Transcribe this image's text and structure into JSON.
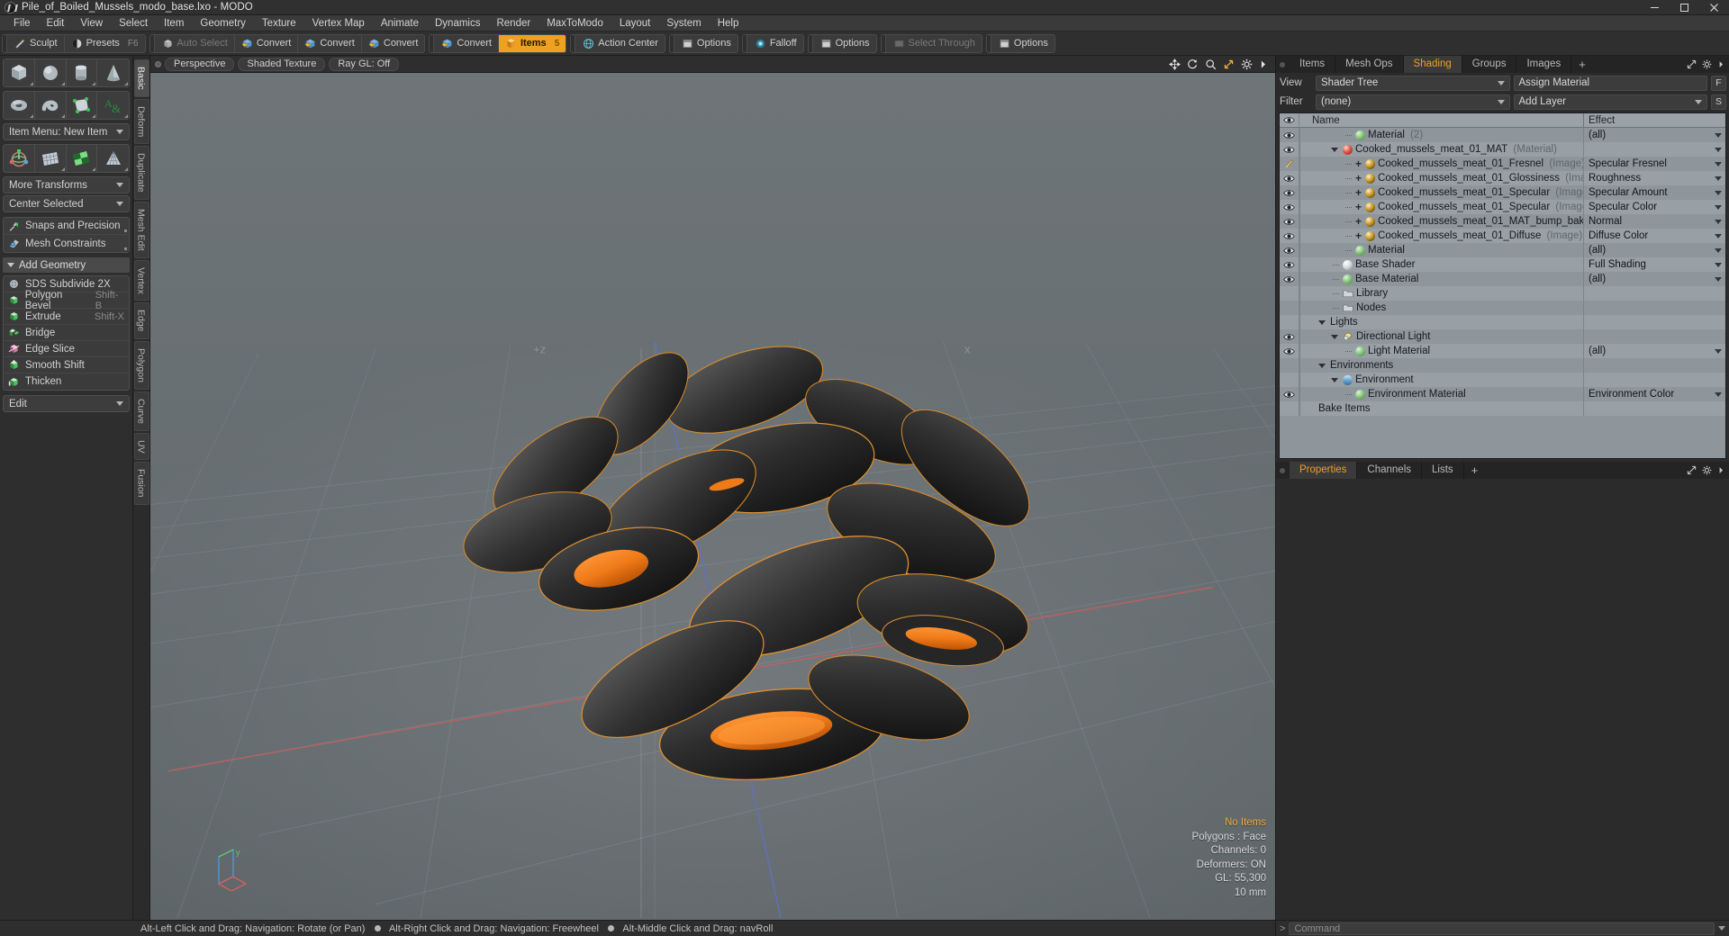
{
  "window": {
    "title": "Pile_of_Boiled_Mussels_modo_base.lxo - MODO",
    "minimize": "─",
    "maximize": "□",
    "close": "✕"
  },
  "menubar": [
    "File",
    "Edit",
    "View",
    "Select",
    "Item",
    "Geometry",
    "Texture",
    "Vertex Map",
    "Animate",
    "Dynamics",
    "Render",
    "MaxToModo",
    "Layout",
    "System",
    "Help"
  ],
  "toolbar": {
    "group1": [
      {
        "label": "Sculpt",
        "icon": "pencil-icon",
        "state": "normal",
        "key": ""
      },
      {
        "label": "Presets",
        "icon": "sphere-icon",
        "state": "normal",
        "key": "F6"
      }
    ],
    "group2": [
      {
        "label": "Auto Select",
        "icon": "cube-grey-icon",
        "state": "disabled",
        "key": ""
      },
      {
        "label": "Convert",
        "icon": "cube-blue-icon",
        "state": "normal",
        "key": ""
      },
      {
        "label": "Convert",
        "icon": "cube-blue-icon",
        "state": "normal",
        "key": ""
      },
      {
        "label": "Convert",
        "icon": "cube-blue-icon",
        "state": "normal",
        "key": ""
      }
    ],
    "group3": [
      {
        "label": "Convert",
        "icon": "cube-blue-icon",
        "state": "normal",
        "key": ""
      },
      {
        "label": "Items",
        "icon": "cube-orange-icon",
        "state": "active",
        "key": "5"
      }
    ],
    "group4": [
      {
        "label": "Action Center",
        "icon": "globe-icon",
        "state": "normal",
        "key": ""
      }
    ],
    "group5": [
      {
        "label": "Options",
        "icon": "panel-icon",
        "state": "normal",
        "key": ""
      }
    ],
    "group6": [
      {
        "label": "Falloff",
        "icon": "falloff-icon",
        "state": "normal",
        "key": ""
      }
    ],
    "group7": [
      {
        "label": "Options",
        "icon": "panel-icon",
        "state": "normal",
        "key": ""
      }
    ],
    "group8": [
      {
        "label": "Select Through",
        "icon": "through-icon",
        "state": "disabled",
        "key": ""
      }
    ],
    "group9": [
      {
        "label": "Options",
        "icon": "panel-icon",
        "state": "normal",
        "key": ""
      }
    ]
  },
  "left_panel": {
    "primitives_row1": [
      "cube-icon",
      "sphere-icon",
      "cylinder-icon",
      "cone-icon"
    ],
    "primitives_row2": [
      "torus-icon",
      "spiral-icon",
      "polygon-point-icon",
      "text-icon"
    ],
    "item_menu": {
      "label": "Item Menu: New Item"
    },
    "transform_row": [
      "transform-gizmo-icon",
      "grid-flat-icon",
      "checker-green-icon",
      "grid-fan-icon"
    ],
    "more_transforms": "More Transforms",
    "center_selected": "Center Selected",
    "snaps": {
      "label": "Snaps and Precision",
      "icon": "snap-icon"
    },
    "mesh_constraints": {
      "label": "Mesh Constraints",
      "icon": "constraint-icon"
    },
    "add_geometry_header": "Add Geometry",
    "tools": [
      {
        "label": "SDS Subdivide 2X",
        "shortcut": "",
        "icon": "subdivide-icon"
      },
      {
        "label": "Polygon Bevel",
        "shortcut": "Shift-B",
        "icon": "bevel-icon"
      },
      {
        "label": "Extrude",
        "shortcut": "Shift-X",
        "icon": "extrude-icon"
      },
      {
        "label": "Bridge",
        "shortcut": "",
        "icon": "bridge-icon"
      },
      {
        "label": "Edge Slice",
        "shortcut": "",
        "icon": "slice-icon"
      },
      {
        "label": "Smooth Shift",
        "shortcut": "",
        "icon": "smoothshift-icon"
      },
      {
        "label": "Thicken",
        "shortcut": "",
        "icon": "thicken-icon"
      }
    ],
    "edit_dropdown": "Edit"
  },
  "vertical_tabs": [
    {
      "label": "Basic",
      "active": true
    },
    {
      "label": "Deform",
      "active": false
    },
    {
      "label": "Duplicate",
      "active": false
    },
    {
      "label": "Mesh Edit",
      "active": false
    },
    {
      "label": "Vertex",
      "active": false
    },
    {
      "label": "Edge",
      "active": false
    },
    {
      "label": "Polygon",
      "active": false
    },
    {
      "label": "Curve",
      "active": false
    },
    {
      "label": "UV",
      "active": false
    },
    {
      "label": "Fusion",
      "active": false
    }
  ],
  "viewport": {
    "pills": [
      "Perspective",
      "Shaded Texture",
      "Ray GL: Off"
    ],
    "tool_icons": [
      "move-icon",
      "rotate-icon",
      "zoom-icon",
      "fit-icon",
      "gear-icon",
      "chevron-right-icon"
    ],
    "stats": {
      "items": "No Items",
      "polygons": "Polygons : Face",
      "channels": "Channels: 0",
      "deformers": "Deformers: ON",
      "gl": "GL: 55,300",
      "scale": "10 mm"
    },
    "axis_labels": {
      "x": "x",
      "y": "y",
      "z": "z"
    }
  },
  "right_panel": {
    "tabs": [
      {
        "label": "Items",
        "active": false
      },
      {
        "label": "Mesh Ops",
        "active": false
      },
      {
        "label": "Shading",
        "active": true
      },
      {
        "label": "Groups",
        "active": false
      },
      {
        "label": "Images",
        "active": false
      }
    ],
    "tab_plus": "+",
    "controls": {
      "view_label": "View",
      "view_value": "Shader Tree",
      "filter_label": "Filter",
      "filter_value": "(none)",
      "assign_material": "Assign Material",
      "add_layer": "Add Layer",
      "btn_f": "F",
      "btn_s": "S"
    },
    "tree_headers": {
      "eye": "eye-icon",
      "name": "Name",
      "effect": "Effect"
    },
    "tree_rows": [
      {
        "eye": "eye",
        "indent": 3,
        "expander": "",
        "icon": "sphere-green",
        "name": "Material",
        "suffix": "(2)",
        "effect": "(all)",
        "has_caret": true,
        "plus": false
      },
      {
        "eye": "eye",
        "indent": 2,
        "expander": "down",
        "icon": "sphere-red",
        "name": "Cooked_mussels_meat_01_MAT",
        "suffix": "(Material)",
        "effect": "",
        "has_caret": true,
        "plus": false
      },
      {
        "eye": "brush",
        "indent": 3,
        "expander": "",
        "icon": "sphere-gold",
        "name": "Cooked_mussels_meat_01_Fresnel",
        "suffix": "(Image)",
        "effect": "Specular Fresnel",
        "has_caret": true,
        "plus": true
      },
      {
        "eye": "eye",
        "indent": 3,
        "expander": "",
        "icon": "sphere-gold",
        "name": "Cooked_mussels_meat_01_Glossiness",
        "suffix": "(Image)",
        "effect": "Roughness",
        "has_caret": true,
        "plus": true
      },
      {
        "eye": "eye",
        "indent": 3,
        "expander": "",
        "icon": "sphere-gold",
        "name": "Cooked_mussels_meat_01_Specular",
        "suffix": "(Image ...",
        "effect": "Specular Amount",
        "has_caret": true,
        "plus": true
      },
      {
        "eye": "eye",
        "indent": 3,
        "expander": "",
        "icon": "sphere-gold",
        "name": "Cooked_mussels_meat_01_Specular",
        "suffix": "(Image)",
        "effect": "Specular Color",
        "has_caret": true,
        "plus": true
      },
      {
        "eye": "eye",
        "indent": 3,
        "expander": "",
        "icon": "sphere-gold",
        "name": "Cooked_mussels_meat_01_MAT_bump_bak ...",
        "suffix": "",
        "effect": "Normal",
        "has_caret": true,
        "plus": true
      },
      {
        "eye": "eye",
        "indent": 3,
        "expander": "",
        "icon": "sphere-gold",
        "name": "Cooked_mussels_meat_01_Diffuse",
        "suffix": "(Image)",
        "effect": "Diffuse Color",
        "has_caret": true,
        "plus": true
      },
      {
        "eye": "eye",
        "indent": 3,
        "expander": "",
        "icon": "sphere-green",
        "name": "Material",
        "suffix": "",
        "effect": "(all)",
        "has_caret": true,
        "plus": false
      },
      {
        "eye": "eye",
        "indent": 2,
        "expander": "",
        "icon": "sphere-white",
        "name": "Base Shader",
        "suffix": "",
        "effect": "Full Shading",
        "has_caret": true,
        "plus": false
      },
      {
        "eye": "eye",
        "indent": 2,
        "expander": "",
        "icon": "sphere-green",
        "name": "Base Material",
        "suffix": "",
        "effect": "(all)",
        "has_caret": true,
        "plus": false
      },
      {
        "eye": "none",
        "indent": 2,
        "expander": "",
        "icon": "folder",
        "name": "Library",
        "suffix": "",
        "effect": "",
        "has_caret": false,
        "plus": false
      },
      {
        "eye": "none",
        "indent": 2,
        "expander": "",
        "icon": "folder",
        "name": "Nodes",
        "suffix": "",
        "effect": "",
        "has_caret": false,
        "plus": false
      },
      {
        "eye": "none",
        "indent": 1,
        "expander": "down",
        "icon": "none",
        "name": "Lights",
        "suffix": "",
        "effect": "",
        "has_caret": false,
        "plus": false
      },
      {
        "eye": "eye",
        "indent": 2,
        "expander": "down",
        "icon": "light",
        "name": "Directional Light",
        "suffix": "",
        "effect": "",
        "has_caret": false,
        "plus": false
      },
      {
        "eye": "eye",
        "indent": 3,
        "expander": "",
        "icon": "sphere-green",
        "name": "Light Material",
        "suffix": "",
        "effect": "(all)",
        "has_caret": true,
        "plus": false
      },
      {
        "eye": "none",
        "indent": 1,
        "expander": "down",
        "icon": "none",
        "name": "Environments",
        "suffix": "",
        "effect": "",
        "has_caret": false,
        "plus": false
      },
      {
        "eye": "none",
        "indent": 2,
        "expander": "down",
        "icon": "sphere-env",
        "name": "Environment",
        "suffix": "",
        "effect": "",
        "has_caret": false,
        "plus": false
      },
      {
        "eye": "eye",
        "indent": 3,
        "expander": "",
        "icon": "sphere-green",
        "name": "Environment Material",
        "suffix": "",
        "effect": "Environment Color",
        "has_caret": true,
        "plus": false
      },
      {
        "eye": "none",
        "indent": 1,
        "expander": "",
        "icon": "none",
        "name": "Bake Items",
        "suffix": "",
        "effect": "",
        "has_caret": false,
        "plus": false
      }
    ],
    "bottom_tabs": [
      {
        "label": "Properties",
        "active": true
      },
      {
        "label": "Channels",
        "active": false
      },
      {
        "label": "Lists",
        "active": false
      }
    ],
    "bottom_plus": "+"
  },
  "statusbar": {
    "hint1": "Alt-Left Click and Drag: Navigation: Rotate (or Pan)",
    "hint2": "Alt-Right Click and Drag: Navigation: Freewheel",
    "hint3": "Alt-Middle Click and Drag: navRoll",
    "command_placeholder": "Command",
    "command_prefix": ">"
  },
  "colors": {
    "accent": "#f0a020",
    "panel": "#2e2e2e",
    "tree_bg": "#8e969c",
    "viewport_top": "#6e7579"
  }
}
